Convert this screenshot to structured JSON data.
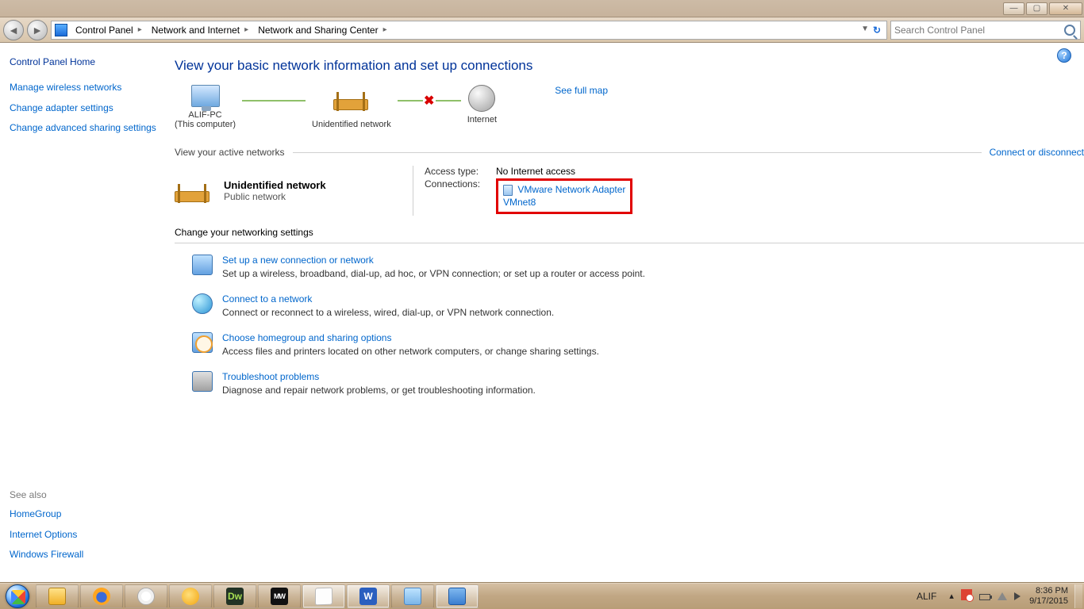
{
  "titlebar": {
    "min": "—",
    "max": "▢",
    "close": "✕"
  },
  "nav": {
    "segments": [
      "Control Panel",
      "Network and Internet",
      "Network and Sharing Center"
    ],
    "search_placeholder": "Search Control Panel"
  },
  "sidebar": {
    "home": "Control Panel Home",
    "links": [
      "Manage wireless networks",
      "Change adapter settings",
      "Change advanced sharing settings"
    ],
    "see_also_label": "See also",
    "see_also": [
      "HomeGroup",
      "Internet Options",
      "Windows Firewall"
    ]
  },
  "content": {
    "title": "View your basic network information and set up connections",
    "see_full_map": "See full map",
    "nodes": {
      "pc": "ALIF-PC",
      "pc_sub": "(This computer)",
      "mid": "Unidentified network",
      "net": "Internet"
    },
    "active_head": "View your active networks",
    "connect_disc": "Connect or disconnect",
    "active": {
      "name": "Unidentified network",
      "type": "Public network",
      "access_label": "Access type:",
      "access_value": "No Internet access",
      "conn_label": "Connections:",
      "conn_link1": "VMware Network Adapter",
      "conn_link2": "VMnet8"
    },
    "change_head": "Change your networking settings",
    "items": [
      {
        "title": "Set up a new connection or network",
        "desc": "Set up a wireless, broadband, dial-up, ad hoc, or VPN connection; or set up a router or access point."
      },
      {
        "title": "Connect to a network",
        "desc": "Connect or reconnect to a wireless, wired, dial-up, or VPN network connection."
      },
      {
        "title": "Choose homegroup and sharing options",
        "desc": "Access files and printers located on other network computers, or change sharing settings."
      },
      {
        "title": "Troubleshoot problems",
        "desc": "Diagnose and repair network problems, or get troubleshooting information."
      }
    ]
  },
  "taskbar": {
    "user": "ALIF",
    "time": "8:36 PM",
    "date": "9/17/2015",
    "dw": "Dw",
    "mw": "MW",
    "word": "W"
  }
}
